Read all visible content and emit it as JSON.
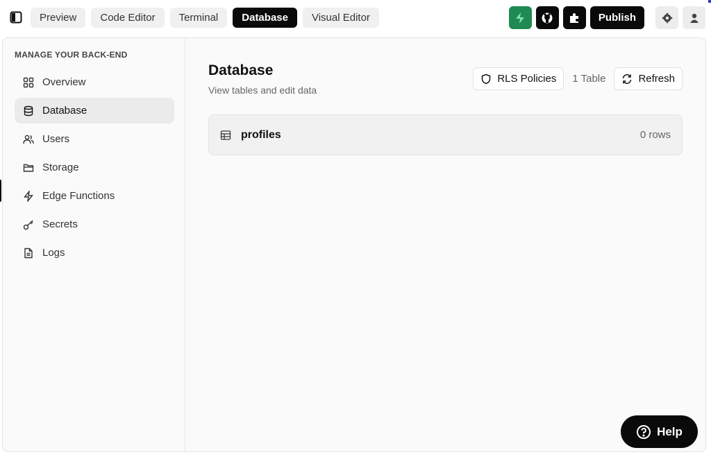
{
  "topbar": {
    "tabs": [
      {
        "label": "Preview",
        "active": false
      },
      {
        "label": "Code Editor",
        "active": false
      },
      {
        "label": "Terminal",
        "active": false
      },
      {
        "label": "Database",
        "active": true
      },
      {
        "label": "Visual Editor",
        "active": false
      }
    ],
    "publish_label": "Publish",
    "icons": [
      "sidebar-toggle-icon",
      "supabase-icon",
      "github-icon",
      "extension-icon",
      "settings-icon",
      "user-icon"
    ],
    "accent_color": "#1f8a53"
  },
  "sidebar": {
    "heading": "MANAGE YOUR BACK-END",
    "items": [
      {
        "label": "Overview",
        "icon": "grid-icon",
        "active": false
      },
      {
        "label": "Database",
        "icon": "database-icon",
        "active": true
      },
      {
        "label": "Users",
        "icon": "users-icon",
        "active": false
      },
      {
        "label": "Storage",
        "icon": "folder-icon",
        "active": false
      },
      {
        "label": "Edge Functions",
        "icon": "lightning-icon",
        "active": false
      },
      {
        "label": "Secrets",
        "icon": "key-icon",
        "active": false
      },
      {
        "label": "Logs",
        "icon": "file-icon",
        "active": false
      }
    ]
  },
  "main": {
    "title": "Database",
    "subtitle": "View tables and edit data",
    "rls_label": "RLS Policies",
    "table_count": "1 Table",
    "refresh_label": "Refresh",
    "tables": [
      {
        "name": "profiles",
        "rows": "0 rows"
      }
    ]
  },
  "help": {
    "label": "Help"
  }
}
